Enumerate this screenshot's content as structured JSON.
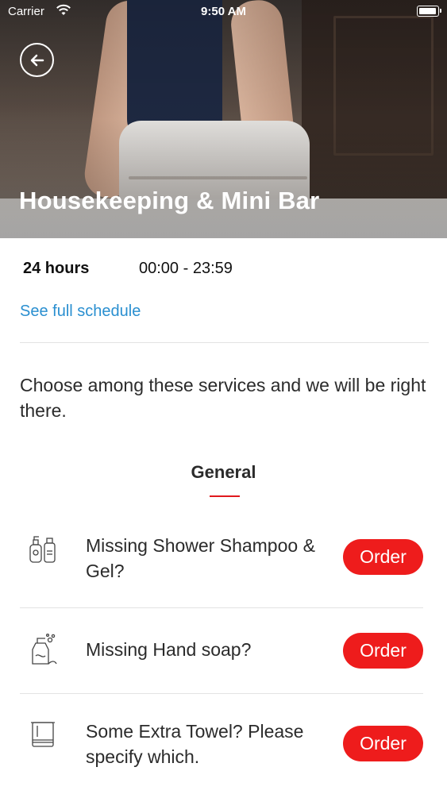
{
  "status_bar": {
    "carrier": "Carrier",
    "time": "9:50 AM"
  },
  "hero": {
    "title": "Housekeeping & Mini Bar"
  },
  "hours": {
    "label": "24 hours",
    "range": "00:00 - 23:59",
    "schedule_link": "See full schedule"
  },
  "intro": "Choose among these services and we will be right there.",
  "section": {
    "title": "General"
  },
  "services": [
    {
      "label": "Missing Shower Shampoo & Gel?",
      "button": "Order",
      "icon": "shampoo-bottles-icon"
    },
    {
      "label": "Missing Hand soap?",
      "button": "Order",
      "icon": "hand-soap-icon"
    },
    {
      "label": "Some Extra Towel? Please specify which.",
      "button": "Order",
      "icon": "towel-icon"
    }
  ],
  "colors": {
    "accent": "#ee1c1c",
    "link": "#2a8fd0"
  }
}
